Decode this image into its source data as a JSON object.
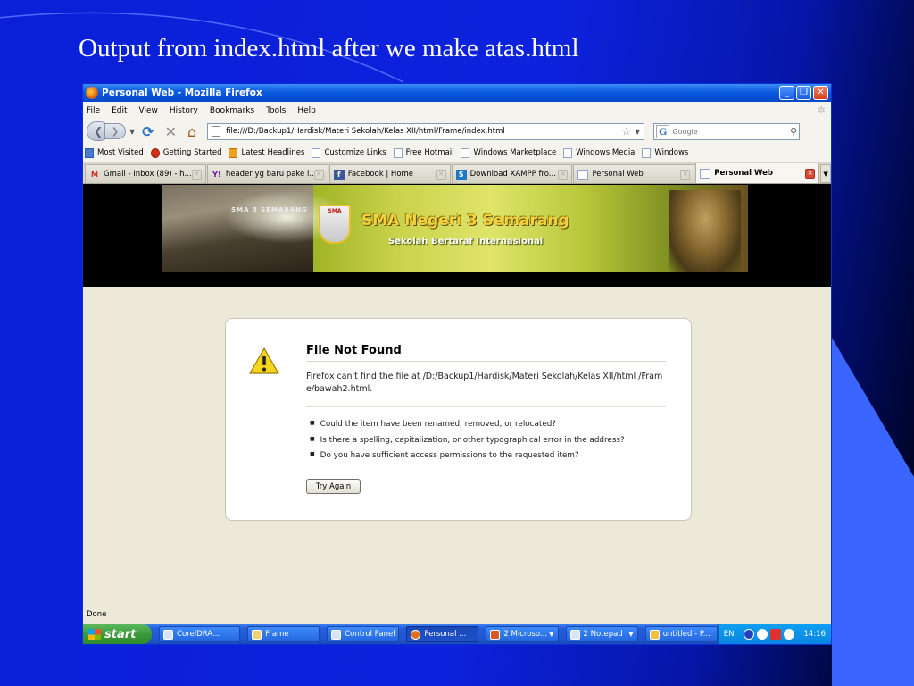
{
  "slide": {
    "title": "Output from index.html after we make atas.html"
  },
  "window": {
    "title": "Personal Web - Mozilla Firefox",
    "buttons": {
      "minimize": "_",
      "maximize": "❐",
      "close": "✕"
    }
  },
  "menu": [
    "File",
    "Edit",
    "View",
    "History",
    "Bookmarks",
    "Tools",
    "Help"
  ],
  "navigation": {
    "url": "file:///D:/Backup1/Hardisk/Materi Sekolah/Kelas XII/html/Frame/index.html",
    "search_engine_letter": "G",
    "search_placeholder": "Google"
  },
  "bookmarks": [
    "Most Visited",
    "Getting Started",
    "Latest Headlines",
    "Customize Links",
    "Free Hotmail",
    "Windows Marketplace",
    "Windows Media",
    "Windows"
  ],
  "tabs": [
    {
      "label": "Gmail - Inbox (89) - h...",
      "icon": "M"
    },
    {
      "label": "header yg baru pake l...",
      "icon": "Y!"
    },
    {
      "label": "Facebook | Home",
      "icon": "f"
    },
    {
      "label": "Download XAMPP fro...",
      "icon": "S"
    },
    {
      "label": "Personal Web",
      "icon": ""
    },
    {
      "label": "Personal Web",
      "icon": ""
    }
  ],
  "banner": {
    "building_sign": "SMA 3 SEMARANG",
    "crest_text": "SMA",
    "school_name": "SMA Negeri 3 Semarang",
    "school_subtitle": "Sekolah Bertaraf Internasional"
  },
  "error": {
    "title": "File Not Found",
    "description": "Firefox can't find the file at /D:/Backup1/Hardisk/Materi Sekolah/Kelas XII/html /Frame/bawah2.html.",
    "reasons": [
      "Could the item have been renamed, removed, or relocated?",
      "Is there a spelling, capitalization, or other typographical error in the address?",
      "Do you have sufficient access permissions to the requested item?"
    ],
    "button_label": "Try Again"
  },
  "status": "Done",
  "taskbar": {
    "start_label": "start",
    "tasks": [
      "CorelDRA...",
      "Frame",
      "Control Panel",
      "Personal ...",
      "2 Microso...",
      "2 Notepad",
      "untitled - P..."
    ],
    "language": "EN",
    "clock": "14:16"
  }
}
